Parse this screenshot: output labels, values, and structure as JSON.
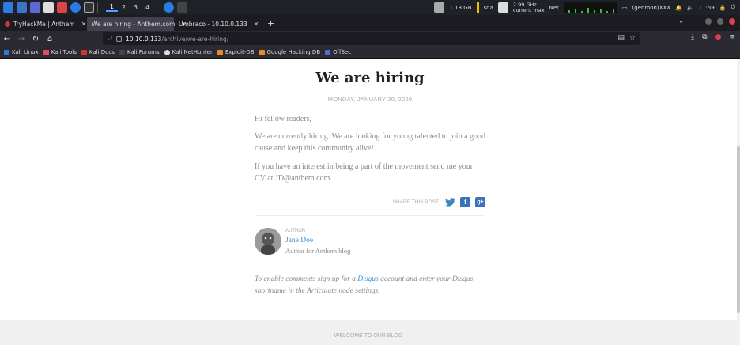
{
  "panel": {
    "workspaces": [
      "1",
      "2",
      "3",
      "4"
    ],
    "active_workspace": "1",
    "disk": "1.13 GB",
    "disk_label": "sda",
    "cpu_freq": "2.99 GHz",
    "cpu_mode": "current max",
    "net_label": "Net",
    "user": "(genmon)XXX",
    "clock": "11:59"
  },
  "tabs": [
    {
      "label": "TryHackMe | Anthem",
      "active": false,
      "color": "#c8363c"
    },
    {
      "label": "We are hiring - Anthem.com",
      "active": true,
      "color": "#888888"
    },
    {
      "label": "Umbraco - 10.10.0.133",
      "active": false,
      "color": "#888888"
    }
  ],
  "url": {
    "host": "10.10.0.133",
    "path": "/archive/we-are-hiring/"
  },
  "bookmarks": [
    {
      "label": "Kali Linux",
      "color": "#2b7be0"
    },
    {
      "label": "Kali Tools",
      "color": "#e84a5f"
    },
    {
      "label": "Kali Docs",
      "color": "#d23232"
    },
    {
      "label": "Kali Forums",
      "color": "#444444"
    },
    {
      "label": "Kali NetHunter",
      "color": "#dddddd"
    },
    {
      "label": "Exploit-DB",
      "color": "#e88a2a"
    },
    {
      "label": "Google Hacking DB",
      "color": "#e88a2a"
    },
    {
      "label": "OffSec",
      "color": "#4a6ee0"
    }
  ],
  "post": {
    "title": "We are hiring",
    "date": "MONDAY, JANUARY 20, 2020",
    "p1": "Hi fellow readers,",
    "p2": "We are currently hiring. We are looking for young talented to join a good cause and keep this community alive!",
    "p3": "If you have an interest in being a part of the movement send me your CV at JD@anthem.com",
    "share_label": "SHARE THIS POST"
  },
  "author": {
    "label": "AUTHOR",
    "name": "Jane Doe",
    "bio": "Author for Anthem blog"
  },
  "comments": {
    "before": "To enable comments sign up for a ",
    "link": "Disqus",
    "after": " account and enter your Disqus shortname in the Articulate node settings."
  },
  "footer": {
    "text": "WELCOME TO OUR BLOG"
  }
}
